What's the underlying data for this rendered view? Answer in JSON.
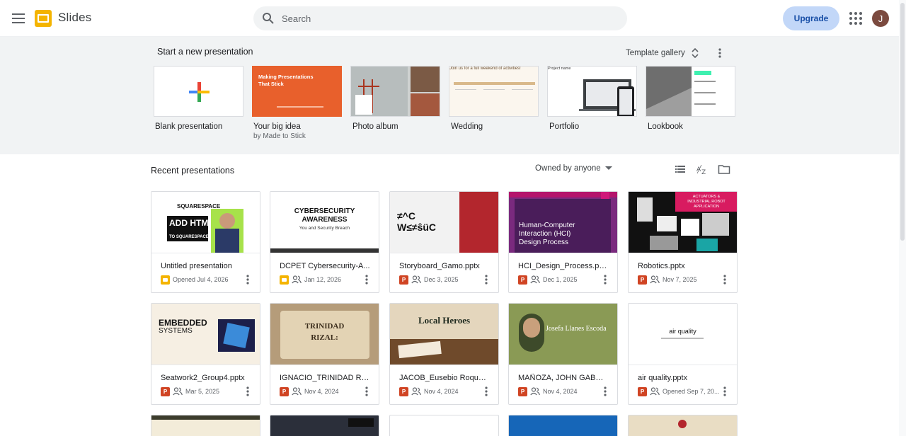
{
  "app": {
    "name": "Slides"
  },
  "search": {
    "placeholder": "Search",
    "value": ""
  },
  "header": {
    "upgrade_label": "Upgrade",
    "avatar_initial": "J"
  },
  "templates": {
    "title": "Start a new presentation",
    "gallery_label": "Template gallery",
    "items": [
      {
        "label": "Blank presentation",
        "sub": ""
      },
      {
        "label": "Your big idea",
        "sub": "by Made to Stick",
        "thumb_text": "Making Presentations That Stick"
      },
      {
        "label": "Photo album",
        "sub": ""
      },
      {
        "label": "Wedding",
        "sub": "",
        "thumb_text": "Join us for a full weekend of activities!"
      },
      {
        "label": "Portfolio",
        "sub": "",
        "thumb_text": "Project name"
      },
      {
        "label": "Lookbook",
        "sub": ""
      }
    ]
  },
  "recent": {
    "title": "Recent presentations",
    "owner_filter": "Owned by anyone",
    "docs": [
      {
        "name": "Untitled presentation",
        "meta": "Opened Jul 4, 2026",
        "type": "slides",
        "shared": false,
        "thumb": [
          "SQUARESPACE",
          "ADD HTML",
          "TO SQUARESPACE"
        ]
      },
      {
        "name": "DCPET Cybersecurity-A...",
        "meta": "Jan 12, 2026",
        "type": "slides",
        "shared": true,
        "thumb": [
          "CYBERSECURITY",
          "AWARENESS",
          "You and Security Breach"
        ]
      },
      {
        "name": "Storyboard_Gamo.pptx",
        "meta": "Dec 3, 2025",
        "type": "pptx",
        "shared": true,
        "thumb": [
          "≠^C",
          "W≤≠ŝüC"
        ]
      },
      {
        "name": "HCI_Design_Process.pptx",
        "meta": "Dec 1, 2025",
        "type": "pptx",
        "shared": true,
        "thumb": [
          "Human-Computer",
          "Interaction (HCI)",
          "Design Process"
        ]
      },
      {
        "name": "Robotics.pptx",
        "meta": "Nov 7, 2025",
        "type": "pptx",
        "shared": true,
        "thumb": [
          "ACTUATORS &",
          "INDUSTRIAL ROBOT",
          "APPLICATION"
        ]
      },
      {
        "name": "Seatwork2_Group4.pptx",
        "meta": "Mar 5, 2025",
        "type": "pptx",
        "shared": true,
        "thumb": [
          "EMBEDDED",
          "SYSTEMS"
        ]
      },
      {
        "name": "IGNACIO_TRINIDAD RIZA...",
        "meta": "Nov 4, 2024",
        "type": "pptx",
        "shared": true,
        "thumb": [
          "TRINIDAD",
          "RIZAL:"
        ]
      },
      {
        "name": "JACOB_Eusebio Roque.p...",
        "meta": "Nov 4, 2024",
        "type": "pptx",
        "shared": true,
        "thumb": [
          "Local Heroes"
        ]
      },
      {
        "name": "MAÑOZA, JOHN GABRIEL...",
        "meta": "Nov 4, 2024",
        "type": "pptx",
        "shared": true,
        "thumb": [
          "Josefa Llanes Escoda"
        ]
      },
      {
        "name": "air quality.pptx",
        "meta": "Opened Sep 7, 20...",
        "type": "pptx",
        "shared": true,
        "thumb": [
          "air quality"
        ]
      }
    ]
  },
  "icons": {
    "menu": "menu-icon",
    "search": "search-icon",
    "apps": "apps-grid-icon",
    "sort": "sort-az-icon",
    "list": "list-view-icon",
    "folder": "folder-icon"
  },
  "colors": {
    "accent": "#1a73e8",
    "slides_yellow": "#f4b400",
    "pptx_red": "#d04423",
    "upgrade_bg": "#c2d7f8"
  }
}
